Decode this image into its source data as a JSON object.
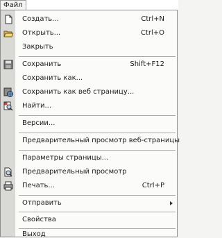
{
  "menubar": {
    "file_label": "Файл"
  },
  "menu": {
    "create": {
      "label": "Создать...",
      "shortcut": "Ctrl+N"
    },
    "open": {
      "label": "Открыть...",
      "shortcut": "Ctrl+O"
    },
    "close": {
      "label": "Закрыть"
    },
    "save": {
      "label": "Сохранить",
      "shortcut": "Shift+F12"
    },
    "save_as": {
      "label": "Сохранить как..."
    },
    "save_web": {
      "label": "Сохранить как веб страницу..."
    },
    "find": {
      "label": "Найти..."
    },
    "versions": {
      "label": "Версии..."
    },
    "web_preview": {
      "label": "Предварительный просмотр веб-страницы"
    },
    "page_setup": {
      "label": "Параметры страницы..."
    },
    "print_preview": {
      "label": "Предварительный просмотр"
    },
    "print": {
      "label": "Печать...",
      "shortcut": "Ctrl+P"
    },
    "send": {
      "label": "Отправить"
    },
    "properties": {
      "label": "Свойства"
    },
    "exit": {
      "label": "Выход"
    }
  }
}
